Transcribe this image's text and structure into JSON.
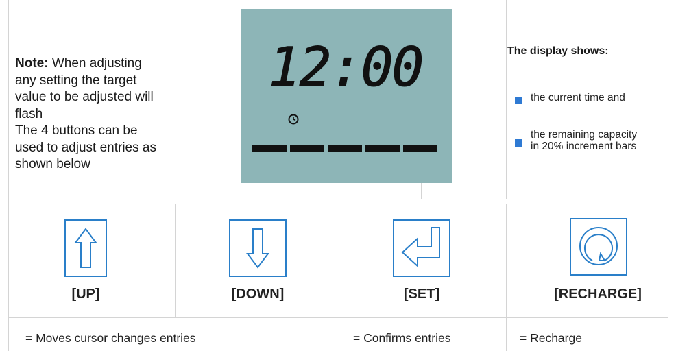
{
  "note": {
    "label": "Note:",
    "line1_rest": "When adjusting",
    "line2": "any setting the target",
    "line3": "value to be adjusted will",
    "line4": "flash",
    "line5": "The 4 buttons can be",
    "line6": "used to adjust entries as",
    "line7": "shown below"
  },
  "lcd": {
    "time": "12:00",
    "clock_icon": "clock-icon",
    "capacity_bars": 5,
    "background_color": "#8db5b7"
  },
  "display_info": {
    "title": "The display shows:",
    "bullets": [
      {
        "lines": [
          "the current time and"
        ]
      },
      {
        "lines": [
          "the remaining capacity",
          "in 20% increment bars"
        ]
      }
    ],
    "bullet_color": "#2f7ad3"
  },
  "buttons": [
    {
      "icon": "arrow-up-icon",
      "label": "[UP]"
    },
    {
      "icon": "arrow-down-icon",
      "label": "[DOWN]"
    },
    {
      "icon": "enter-icon",
      "label": "[SET]"
    },
    {
      "icon": "recharge-icon",
      "label": "[RECHARGE]"
    }
  ],
  "descriptions": {
    "up_down": "= Moves cursor changes entries",
    "set": "= Confirms entries",
    "recharge": "= Recharge"
  },
  "icon_color": "#2a7fc9"
}
